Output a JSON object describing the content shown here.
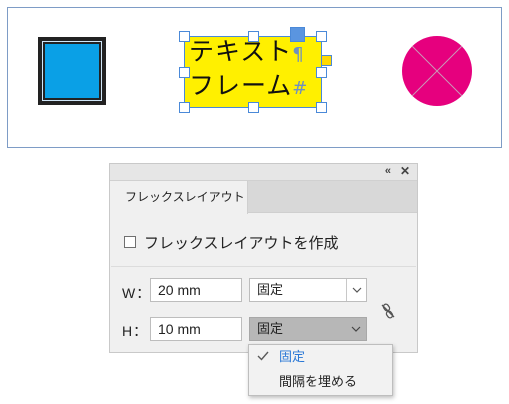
{
  "canvas": {
    "text_frame": {
      "line1": "テキスト",
      "line2": "フレーム",
      "paragraph_mark": "¶",
      "end_mark": "#",
      "fill_color": "#fff000"
    },
    "square_color": "#0aa0e6",
    "circle_color": "#e6007e",
    "selection_color": "#4a89d8"
  },
  "panel": {
    "collapse_icon": "«",
    "close_icon": "✕",
    "tab_label": "フレックスレイアウト",
    "create_checkbox_label": "フレックスレイアウトを作成",
    "width_label": "W：",
    "width_value": "20 mm",
    "width_mode": "固定",
    "height_label": "H：",
    "height_value": "10 mm",
    "height_mode": "固定",
    "link_icon": "unlinked-chain-icon"
  },
  "dropdown": {
    "items": [
      {
        "label": "固定",
        "selected": true
      },
      {
        "label": "間隔を埋める",
        "selected": false
      }
    ]
  }
}
